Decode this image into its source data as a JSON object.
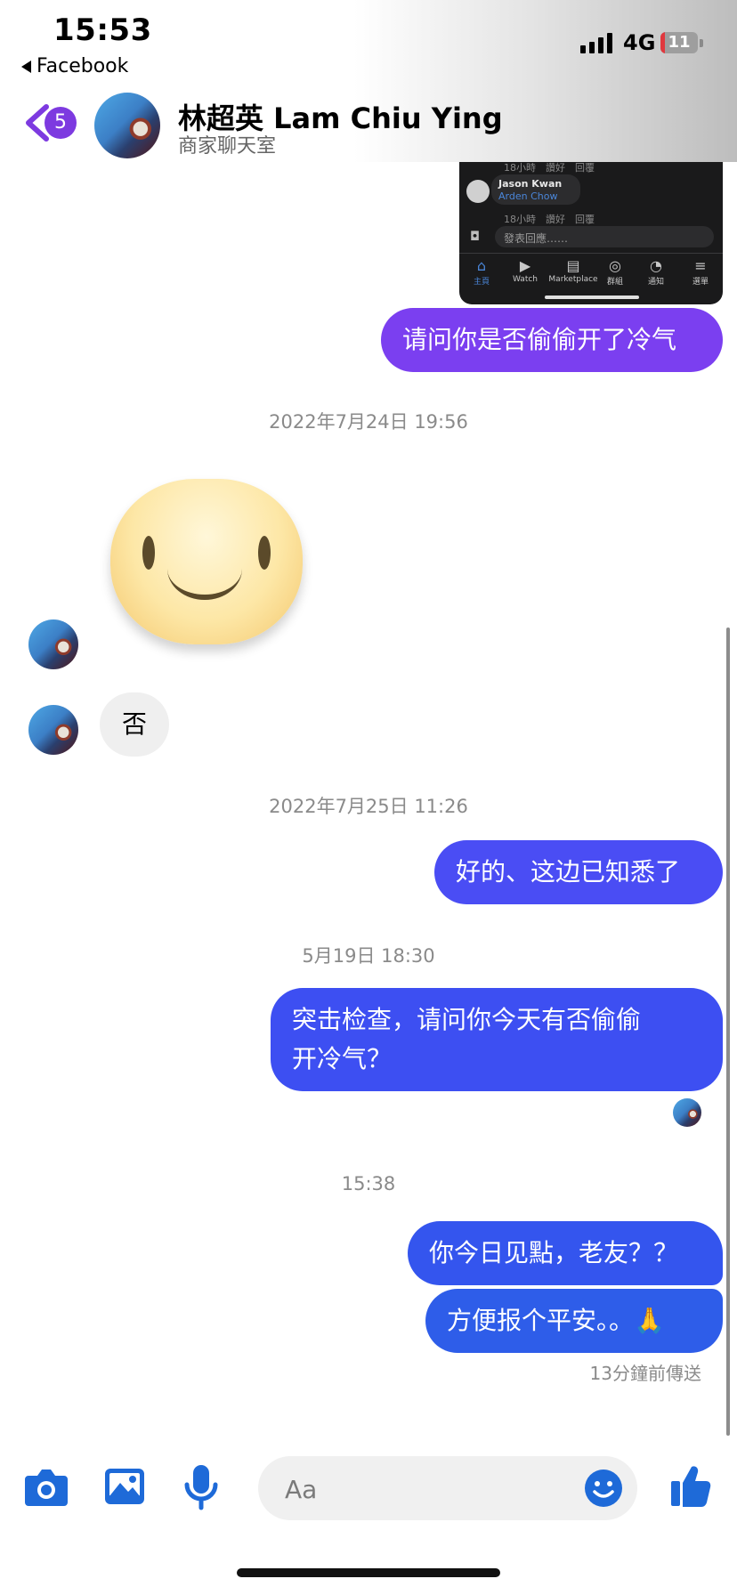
{
  "status": {
    "time": "15:53",
    "back_app": "Facebook",
    "network": "4G",
    "battery": "11",
    "battery_level_percent": 11
  },
  "header": {
    "badge": "5",
    "name": "林超英 Lam Chiu Ying",
    "subtitle": "商家聊天室"
  },
  "embedded_screenshot": {
    "meta_top": "18小時　讚好　回覆",
    "comment_name": "Jason Kwan",
    "comment_tag": "Arden Chow",
    "meta_bottom": "18小時　讚好　回覆",
    "reply_placeholder": "發表回應……",
    "tabs": [
      "主頁",
      "Watch",
      "Marketplace",
      "群組",
      "通知",
      "選單"
    ]
  },
  "messages": {
    "m1": "请问你是否偷偷开了冷气",
    "ts1": "2022年7月24日 19:56",
    "in1": "否",
    "ts2": "2022年7月25日 11:26",
    "m2": "好的、这边已知悉了",
    "ts3": "5月19日 18:30",
    "m3_line1": "突击检查，请问你今天有否偷偷",
    "m3_line2": "开冷气？",
    "ts4": "15:38",
    "m4": "你今日见點，老友？？",
    "m5": "方便报个平安。。🙏",
    "sent_status": "13分鐘前傳送"
  },
  "composer": {
    "placeholder": "Aa"
  },
  "colors": {
    "accent": "#7d3ae0",
    "bubble_purple": "#7b3ff0",
    "bubble_blue": "#3d4ff2",
    "bubble_blue2": "#2e5de9",
    "icon_blue": "#1e6ad8"
  }
}
